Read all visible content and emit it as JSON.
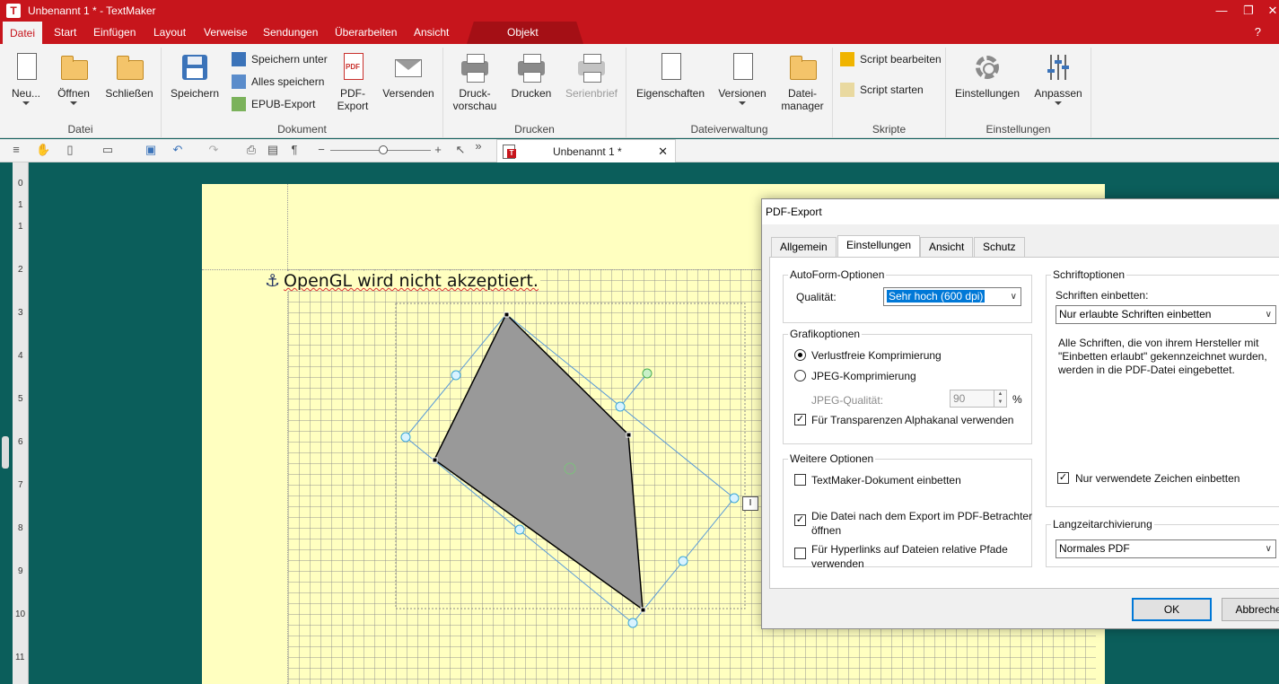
{
  "app": {
    "icon_letter": "T",
    "window_title": "Unbenannt 1 * - TextMaker",
    "controls": {
      "minimize": "—",
      "maximize": "❐",
      "close": "✕"
    }
  },
  "menu": {
    "tabs": [
      "Datei",
      "Start",
      "Einfügen",
      "Layout",
      "Verweise",
      "Sendungen",
      "Überarbeiten",
      "Ansicht"
    ],
    "context_tab": "Objekt",
    "help": "?"
  },
  "ribbon": {
    "datei": {
      "label": "Datei",
      "neu": "Neu...",
      "oeffnen": "Öffnen",
      "schliessen": "Schließen"
    },
    "dokument": {
      "label": "Dokument",
      "speichern": "Speichern",
      "speichern_unter": "Speichern unter",
      "alles_speichern": "Alles speichern",
      "epub_export": "EPUB-Export",
      "pdf_export_1": "PDF-",
      "pdf_export_2": "Export",
      "versenden": "Versenden"
    },
    "drucken": {
      "label": "Drucken",
      "druckvorschau_1": "Druck-",
      "druckvorschau_2": "vorschau",
      "drucken": "Drucken",
      "serienbrief": "Serienbrief"
    },
    "dateiverwaltung": {
      "label": "Dateiverwaltung",
      "eigenschaften": "Eigenschaften",
      "versionen": "Versionen",
      "dateimanager_1": "Datei-",
      "dateimanager_2": "manager"
    },
    "skripte": {
      "label": "Skripte",
      "script_bearbeiten": "Script bearbeiten",
      "script_starten": "Script starten"
    },
    "einstellungen": {
      "label": "Einstellungen",
      "einstellungen": "Einstellungen",
      "anpassen": "Anpassen"
    }
  },
  "quickbar": {
    "document_tab": "Unbenannt 1 *",
    "zoom_minus": "−",
    "zoom_plus": "+",
    "pilcrow": "¶",
    "more": "»"
  },
  "ruler": [
    "0",
    "1",
    "1",
    "2",
    "3",
    "4",
    "5",
    "6",
    "7",
    "8",
    "9",
    "10",
    "11"
  ],
  "page": {
    "text": "OpenGL wird nicht akzeptiert.",
    "anchor": "⚓",
    "textframe_icon": "I"
  },
  "dialog": {
    "title": "PDF-Export",
    "tabs": [
      "Allgemein",
      "Einstellungen",
      "Ansicht",
      "Schutz"
    ],
    "active_tab": "Einstellungen",
    "autoform": {
      "legend": "AutoForm-Optionen",
      "quality_label": "Qualität:",
      "quality_value": "Sehr hoch (600 dpi)"
    },
    "grafik": {
      "legend": "Grafikoptionen",
      "verlustfrei": "Verlustfreie Komprimierung",
      "jpeg": "JPEG-Komprimierung",
      "jpeg_quality_label": "JPEG-Qualität:",
      "jpeg_quality_value": "90",
      "percent": "%",
      "alpha": "Für Transparenzen Alphakanal verwenden"
    },
    "weitere": {
      "legend": "Weitere Optionen",
      "einbetten": "TextMaker-Dokument einbetten",
      "oeffnen_1": "Die Datei nach dem Export im PDF-Betrachter",
      "oeffnen_2": "öffnen",
      "hyperlinks_1": "Für Hyperlinks auf Dateien relative Pfade",
      "hyperlinks_2": "verwenden"
    },
    "schrift": {
      "legend": "Schriftoptionen",
      "einbetten_label": "Schriften einbetten:",
      "einbetten_value": "Nur erlaubte Schriften einbetten",
      "info_1": "Alle Schriften, die von ihrem Hersteller mit",
      "info_2": "\"Einbetten erlaubt\" gekennzeichnet wurden,",
      "info_3": "werden in die PDF-Datei eingebettet.",
      "nur_verwendete": "Nur verwendete Zeichen einbetten"
    },
    "langzeit": {
      "legend": "Langzeitarchivierung",
      "value": "Normales PDF"
    },
    "ok": "OK",
    "cancel": "Abbrechen",
    "checked_mark": "✓",
    "dropdown_arrow": "∨",
    "spin_up": "▲",
    "spin_down": "▼"
  },
  "colors": {
    "brand_red": "#c7151c",
    "workspace": "#0b5e5b",
    "page": "#ffffc0",
    "shape_fill": "#999999",
    "selection": "#0078d7"
  }
}
